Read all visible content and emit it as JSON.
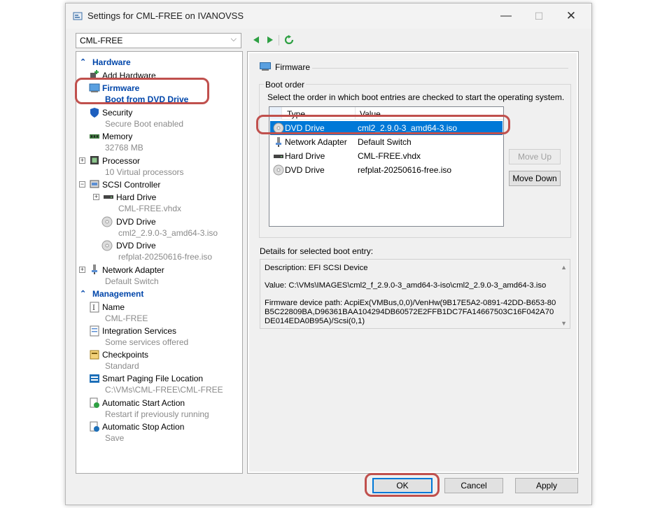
{
  "window": {
    "title": "Settings for CML-FREE on IVANOVSS",
    "minimize": "—",
    "maximize": "☐",
    "close": "✕"
  },
  "vm_selector": {
    "value": "CML-FREE"
  },
  "tree": {
    "hardware_header": "Hardware",
    "add_hardware": "Add Hardware",
    "firmware": {
      "label": "Firmware",
      "sub": "Boot from DVD Drive"
    },
    "security": {
      "label": "Security",
      "sub": "Secure Boot enabled"
    },
    "memory": {
      "label": "Memory",
      "sub": "32768 MB"
    },
    "processor": {
      "label": "Processor",
      "sub": "10 Virtual processors"
    },
    "scsi": {
      "label": "SCSI Controller"
    },
    "hard_drive": {
      "label": "Hard Drive",
      "sub": "CML-FREE.vhdx"
    },
    "dvd1": {
      "label": "DVD Drive",
      "sub": "cml2_2.9.0-3_amd64-3.iso"
    },
    "dvd2": {
      "label": "DVD Drive",
      "sub": "refplat-20250616-free.iso"
    },
    "network": {
      "label": "Network Adapter",
      "sub": "Default Switch"
    },
    "management_header": "Management",
    "name": {
      "label": "Name",
      "sub": "CML-FREE"
    },
    "integration": {
      "label": "Integration Services",
      "sub": "Some services offered"
    },
    "checkpoints": {
      "label": "Checkpoints",
      "sub": "Standard"
    },
    "paging": {
      "label": "Smart Paging File Location",
      "sub": "C:\\VMs\\CML-FREE\\CML-FREE"
    },
    "auto_start": {
      "label": "Automatic Start Action",
      "sub": "Restart if previously running"
    },
    "auto_stop": {
      "label": "Automatic Stop Action",
      "sub": "Save"
    }
  },
  "panel": {
    "heading": "Firmware",
    "boot_order_title": "Boot order",
    "boot_order_desc": "Select the order in which boot entries are checked to start the operating system.",
    "columns": {
      "type": "Type",
      "value": "Value"
    },
    "entries": [
      {
        "type": "DVD Drive",
        "value": "cml2_2.9.0-3_amd64-3.iso",
        "icon": "dvd-icon"
      },
      {
        "type": "Network Adapter",
        "value": "Default Switch",
        "icon": "network-adapter-icon"
      },
      {
        "type": "Hard Drive",
        "value": "CML-FREE.vhdx",
        "icon": "hard-drive-icon"
      },
      {
        "type": "DVD Drive",
        "value": "refplat-20250616-free.iso",
        "icon": "dvd-icon"
      }
    ],
    "move_up": "Move Up",
    "move_down": "Move Down",
    "details_label": "Details for selected boot entry:",
    "details": {
      "description": "Description: EFI SCSI Device",
      "value": "Value: C:\\VMs\\IMAGES\\cml2_f_2.9.0-3_amd64-3-iso\\cml2_2.9.0-3_amd64-3.iso",
      "device_path": "Firmware device path: AcpiEx(VMBus,0,0)/VenHw(9B17E5A2-0891-42DD-B653-80B5C22809BA,D96361BAA104294DB60572E2FFB1DC7FA14667503C16F042A70DE014EDA0B95A)/Scsi(0,1)"
    }
  },
  "footer": {
    "ok": "OK",
    "cancel": "Cancel",
    "apply": "Apply"
  },
  "colors": {
    "accent": "#0078d7",
    "tree_header": "#0046aa",
    "highlight": "#c0504d"
  }
}
